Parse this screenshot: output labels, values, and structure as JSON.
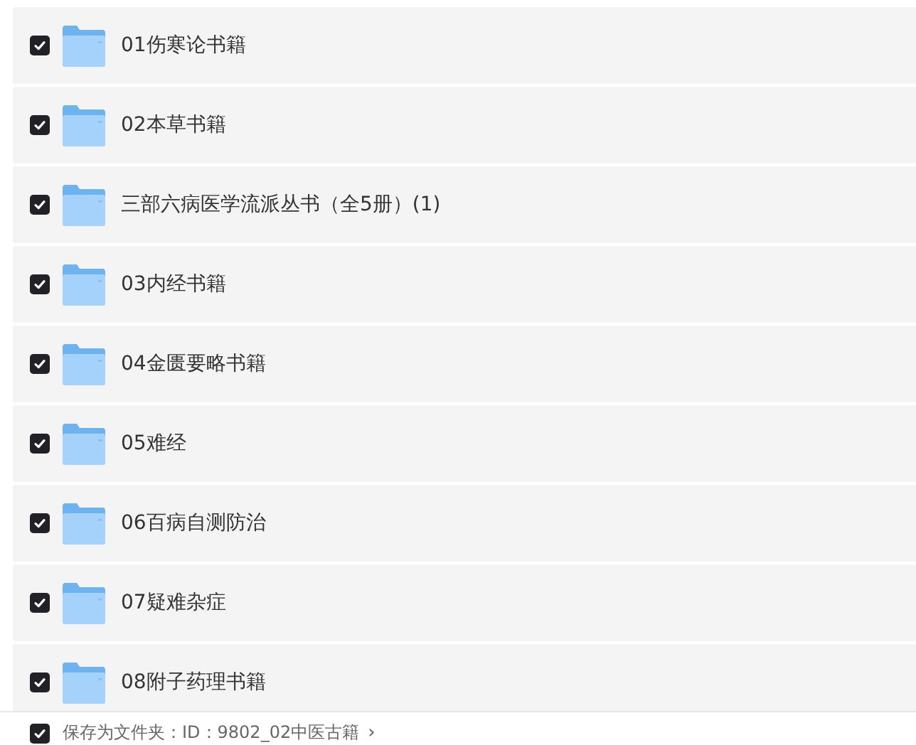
{
  "folders": [
    {
      "name": "01伤寒论书籍",
      "checked": true
    },
    {
      "name": "02本草书籍",
      "checked": true
    },
    {
      "name": "三部六病医学流派丛书（全5册）(1)",
      "checked": true
    },
    {
      "name": "03内经书籍",
      "checked": true
    },
    {
      "name": "04金匮要略书籍",
      "checked": true
    },
    {
      "name": "05难经",
      "checked": true
    },
    {
      "name": "06百病自测防治",
      "checked": true
    },
    {
      "name": "07疑难杂症",
      "checked": true
    },
    {
      "name": "08附子药理书籍",
      "checked": true
    }
  ],
  "save_option": {
    "checked": true,
    "label": "保存为文件夹：ID：9802_02中医古籍",
    "arrow": "›"
  }
}
